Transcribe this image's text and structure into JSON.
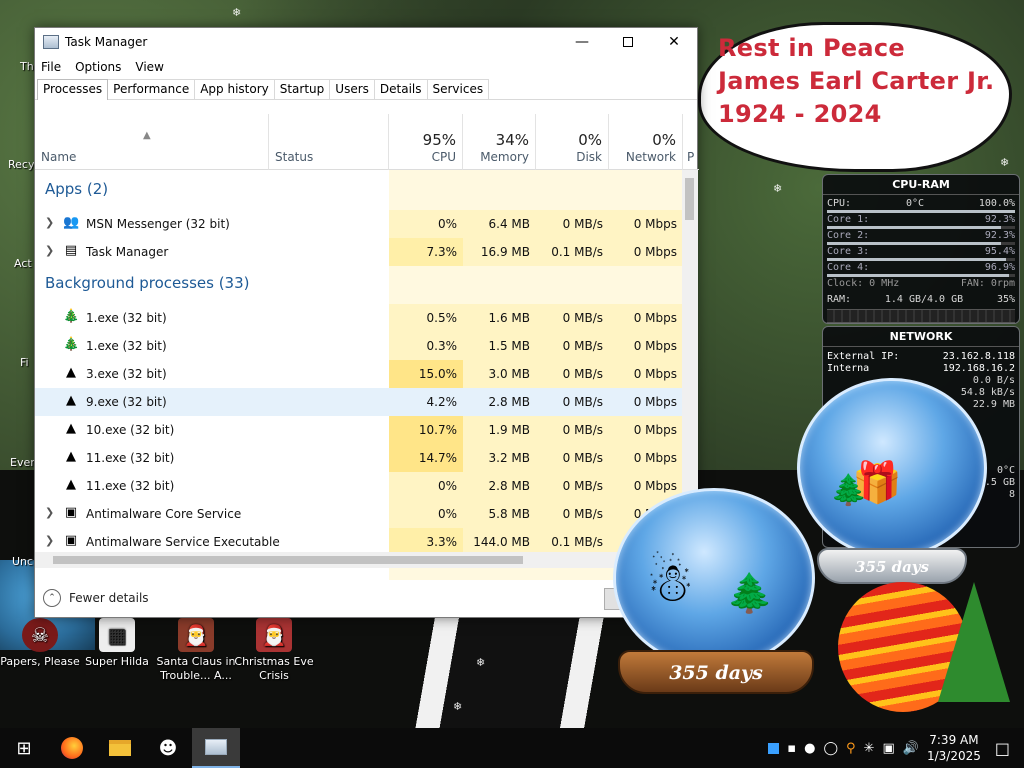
{
  "desktop": {
    "speech": [
      "Rest in Peace",
      "James Earl Carter Jr.",
      "1924 - 2024"
    ],
    "icons": [
      {
        "label": "Papers, Please",
        "glyph": "☠"
      },
      {
        "label": "Super Hilda",
        "glyph": "▦"
      },
      {
        "label": "Santa Claus in Trouble... A...",
        "glyph": "🎅"
      },
      {
        "label": "Christmas Eve Crisis",
        "glyph": "🎅"
      }
    ],
    "partial_labels": [
      "Th",
      "Recy",
      "Act",
      "Fi",
      "Ever",
      "Unc"
    ],
    "globe1_days": "355 days",
    "globe2_days": "355 days"
  },
  "cpu_widget": {
    "title": "CPU-RAM",
    "cpu_label": "CPU:",
    "cpu_temp": "0°C",
    "cpu_value": "100.0%",
    "cores": [
      {
        "label": "Core 1:",
        "value": "92.3%",
        "fill": 0.923
      },
      {
        "label": "Core 2:",
        "value": "92.3%",
        "fill": 0.923
      },
      {
        "label": "Core 3:",
        "value": "95.4%",
        "fill": 0.954
      },
      {
        "label": "Core 4:",
        "value": "96.9%",
        "fill": 0.969
      }
    ],
    "clock": "Clock: 0 MHz",
    "fan": "FAN: 0rpm",
    "ram_label": "RAM:",
    "ram_value": "1.4 GB/4.0 GB",
    "ram_pct": "35%"
  },
  "net_widget": {
    "title": "NETWORK",
    "external_label": "External IP:",
    "external_ip": "23.162.8.118",
    "internal_label": "Interna",
    "internal_ip": "192.168.16.2",
    "rows": [
      "0.0 B/s",
      "54.8 kB/s",
      "22.9 MB"
    ],
    "temp": "0°C",
    "size": "9.5 GB",
    "num": "8"
  },
  "window": {
    "title": "Task Manager",
    "menu": [
      "File",
      "Options",
      "View"
    ],
    "tabs": [
      "Processes",
      "Performance",
      "App history",
      "Startup",
      "Users",
      "Details",
      "Services"
    ],
    "columns": {
      "name": "Name",
      "status": "Status",
      "cpu": {
        "pct": "95%",
        "label": "CPU"
      },
      "memory": {
        "pct": "34%",
        "label": "Memory"
      },
      "disk": {
        "pct": "0%",
        "label": "Disk"
      },
      "network": {
        "pct": "0%",
        "label": "Network"
      },
      "extra": "P"
    },
    "groups": {
      "apps": "Apps (2)",
      "background": "Background processes (33)"
    },
    "app_rows": [
      {
        "name": "MSN Messenger (32 bit)",
        "cpu": "0%",
        "mem": "6.4 MB",
        "disk": "0 MB/s",
        "net": "0 Mbps",
        "icon": "👥"
      },
      {
        "name": "Task Manager",
        "cpu": "7.3%",
        "mem": "16.9 MB",
        "disk": "0.1 MB/s",
        "net": "0 Mbps",
        "icon": "▤"
      }
    ],
    "bg_rows": [
      {
        "name": "1.exe (32 bit)",
        "cpu": "0.5%",
        "mem": "1.6 MB",
        "disk": "0 MB/s",
        "net": "0 Mbps",
        "icon": "🎄"
      },
      {
        "name": "1.exe (32 bit)",
        "cpu": "0.3%",
        "mem": "1.5 MB",
        "disk": "0 MB/s",
        "net": "0 Mbps",
        "icon": "🎄"
      },
      {
        "name": "3.exe (32 bit)",
        "cpu": "15.0%",
        "mem": "3.0 MB",
        "disk": "0 MB/s",
        "net": "0 Mbps",
        "icon": "▲"
      },
      {
        "name": "9.exe (32 bit)",
        "cpu": "4.2%",
        "mem": "2.8 MB",
        "disk": "0 MB/s",
        "net": "0 Mbps",
        "icon": "▲"
      },
      {
        "name": "10.exe (32 bit)",
        "cpu": "10.7%",
        "mem": "1.9 MB",
        "disk": "0 MB/s",
        "net": "0 Mbps",
        "icon": "▲"
      },
      {
        "name": "11.exe (32 bit)",
        "cpu": "14.7%",
        "mem": "3.2 MB",
        "disk": "0 MB/s",
        "net": "0 Mbps",
        "icon": "▲"
      },
      {
        "name": "11.exe (32 bit)",
        "cpu": "0%",
        "mem": "2.8 MB",
        "disk": "0 MB/s",
        "net": "0 Mbps",
        "icon": "▲"
      },
      {
        "name": "Antimalware Core Service",
        "cpu": "0%",
        "mem": "5.8 MB",
        "disk": "0 MB/s",
        "net": "0 Mbps",
        "icon": "▣"
      },
      {
        "name": "Antimalware Service Executable",
        "cpu": "3.3%",
        "mem": "144.0 MB",
        "disk": "0.1 MB/s",
        "net": "0 Mbps",
        "icon": "▣"
      }
    ],
    "footer": "Fewer details"
  },
  "taskbar": {
    "time": "7:39 AM",
    "date": "1/3/2025"
  }
}
